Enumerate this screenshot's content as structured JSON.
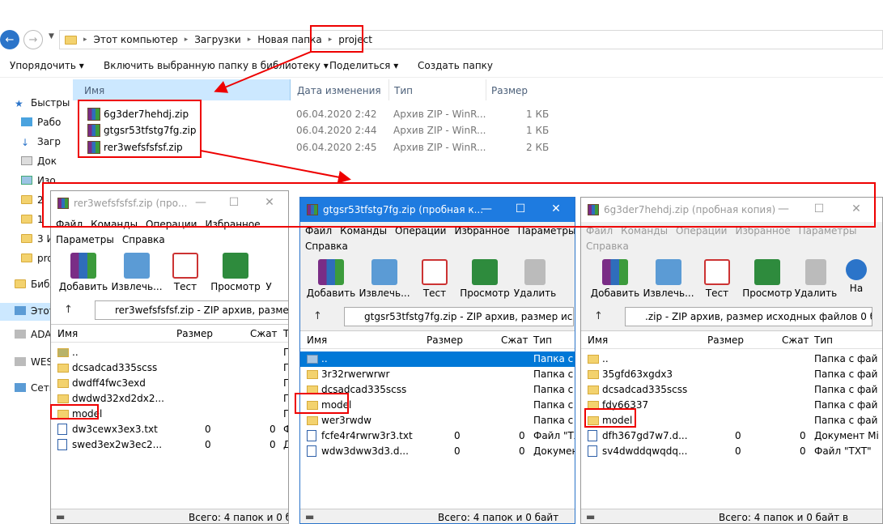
{
  "address": {
    "crumbs": [
      "Этот компьютер",
      "Загрузки",
      "Новая папка",
      "project"
    ]
  },
  "commands": {
    "organize": "Упорядочить",
    "include": "Включить выбранную папку в библиотеку",
    "share": "Поделиться",
    "new_folder": "Создать папку"
  },
  "columns": {
    "name": "Имя",
    "date": "Дата изменения",
    "type": "Тип",
    "size": "Размер"
  },
  "files": [
    {
      "name": "6g3der7hehdj.zip",
      "date": "06.04.2020 2:42",
      "type": "Архив ZIP - WinR...",
      "size": "1 КБ"
    },
    {
      "name": "gtgsr53tfstg7fg.zip",
      "date": "06.04.2020 2:44",
      "type": "Архив ZIP - WinR...",
      "size": "1 КБ"
    },
    {
      "name": "rer3wefsfsfsf.zip",
      "date": "06.04.2020 2:45",
      "type": "Архив ZIP - WinR...",
      "size": "2 КБ"
    }
  ],
  "sidebar": [
    "Быстры",
    "Рабо",
    "Загр",
    "Док",
    "Изо",
    "2 ",
    "1 ",
    "3 И",
    "pro",
    "Библ",
    "Этот",
    "ADA",
    "WES",
    "Сеть"
  ],
  "win1": {
    "title": "rer3wefsfsfsf.zip (про...",
    "menu": [
      "Файл",
      "Команды",
      "Операции",
      "Избранное"
    ],
    "menu2": [
      "Параметры",
      "Справка"
    ],
    "tools": [
      "Добавить",
      "Извлечь...",
      "Тест",
      "Просмотр",
      "У"
    ],
    "path": "rer3wefsfsfsf.zip - ZIP архив, размер",
    "cols": [
      "Имя",
      "Размер",
      "Сжат",
      "Т"
    ],
    "rows": [
      {
        "n": "..",
        "a": "",
        "b": "",
        "c": "П"
      },
      {
        "n": "dcsadcad335scss",
        "a": "",
        "b": "",
        "c": "П"
      },
      {
        "n": "dwdff4fwc3exd",
        "a": "",
        "b": "",
        "c": "П"
      },
      {
        "n": "dwdwd32xd2dx2...",
        "a": "",
        "b": "",
        "c": "П"
      },
      {
        "n": "model",
        "a": "",
        "b": "",
        "c": "П"
      },
      {
        "n": "dw3cewx3ex3.txt",
        "a": "0",
        "b": "0",
        "c": "Ф"
      },
      {
        "n": "swed3ex2w3ec2...",
        "a": "0",
        "b": "0",
        "c": "Д"
      }
    ],
    "status": "Всего: 4 папок и 0 б"
  },
  "win2": {
    "title": "gtgsr53tfstg7fg.zip (пробная к...",
    "menu": [
      "Файл",
      "Команды",
      "Операции",
      "Избранное",
      "Параметры"
    ],
    "menu2": [
      "Справка"
    ],
    "tools": [
      "Добавить",
      "Извлечь...",
      "Тест",
      "Просмотр",
      "Удалить"
    ],
    "path": "gtgsr53tfstg7fg.zip - ZIP архив, размер исход",
    "cols": [
      "Имя",
      "Размер",
      "Сжат",
      "Тип"
    ],
    "rows": [
      {
        "n": "..",
        "a": "",
        "b": "",
        "c": "Папка с ф"
      },
      {
        "n": "3r32rwerwrwr",
        "a": "",
        "b": "",
        "c": "Папка с ф"
      },
      {
        "n": "dcsadcad335scss",
        "a": "",
        "b": "",
        "c": "Папка с ф"
      },
      {
        "n": "model",
        "a": "",
        "b": "",
        "c": "Папка с ф"
      },
      {
        "n": "wer3rwdw",
        "a": "",
        "b": "",
        "c": "Папка с ф"
      },
      {
        "n": "fcfe4r4rwrw3r3.txt",
        "a": "0",
        "b": "0",
        "c": "Файл \"TX"
      },
      {
        "n": "wdw3dww3d3.d...",
        "a": "0",
        "b": "0",
        "c": "Докумен"
      }
    ],
    "status": "Всего: 4 папок и 0 байт"
  },
  "win3": {
    "title": "6g3der7hehdj.zip (пробная копия)",
    "menu": [
      "Файл",
      "Команды",
      "Операции",
      "Избранное",
      "Параметры"
    ],
    "menu2": [
      "Справка"
    ],
    "tools": [
      "Добавить",
      "Извлечь...",
      "Тест",
      "Просмотр",
      "Удалить",
      "На"
    ],
    "path": ".zip - ZIP архив, размер исходных файлов 0 байт",
    "cols": [
      "Имя",
      "Размер",
      "Сжат",
      "Тип"
    ],
    "rows": [
      {
        "n": "..",
        "a": "",
        "b": "",
        "c": "Папка с фай"
      },
      {
        "n": "35gfd63xgdx3",
        "a": "",
        "b": "",
        "c": "Папка с фай"
      },
      {
        "n": "dcsadcad335scss",
        "a": "",
        "b": "",
        "c": "Папка с фай"
      },
      {
        "n": "fdy66337",
        "a": "",
        "b": "",
        "c": "Папка с фай"
      },
      {
        "n": "model",
        "a": "",
        "b": "",
        "c": "Папка с фай"
      },
      {
        "n": "dfh367gd7w7.d...",
        "a": "0",
        "b": "0",
        "c": "Документ Mi"
      },
      {
        "n": "sv4dwddqwqdq...",
        "a": "0",
        "b": "0",
        "c": "Файл \"TXT\""
      }
    ],
    "status": "Всего: 4 папок и 0 байт в"
  }
}
